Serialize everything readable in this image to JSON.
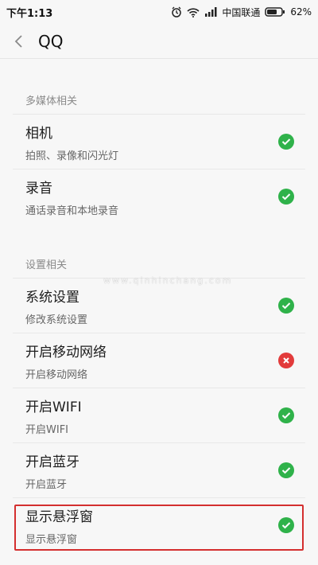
{
  "status_bar": {
    "time": "下午1:13",
    "carrier": "中国联通",
    "battery": "62%"
  },
  "header": {
    "title": "QQ"
  },
  "sections": [
    {
      "title": "多媒体相关",
      "items": [
        {
          "title": "相机",
          "subtitle": "拍照、录像和闪光灯",
          "status": "allowed"
        },
        {
          "title": "录音",
          "subtitle": "通话录音和本地录音",
          "status": "allowed"
        }
      ]
    },
    {
      "title": "设置相关",
      "items": [
        {
          "title": "系统设置",
          "subtitle": "修改系统设置",
          "status": "allowed"
        },
        {
          "title": "开启移动网络",
          "subtitle": "开启移动网络",
          "status": "denied"
        },
        {
          "title": "开启WIFI",
          "subtitle": "开启WIFI",
          "status": "allowed"
        },
        {
          "title": "开启蓝牙",
          "subtitle": "开启蓝牙",
          "status": "allowed"
        },
        {
          "title": "显示悬浮窗",
          "subtitle": "显示悬浮窗",
          "status": "allowed"
        }
      ]
    }
  ],
  "watermark": "www.qinhinchang.com",
  "colors": {
    "allowed": "#2fb24a",
    "denied": "#e23b3b",
    "highlight_border": "#d42f2f"
  }
}
